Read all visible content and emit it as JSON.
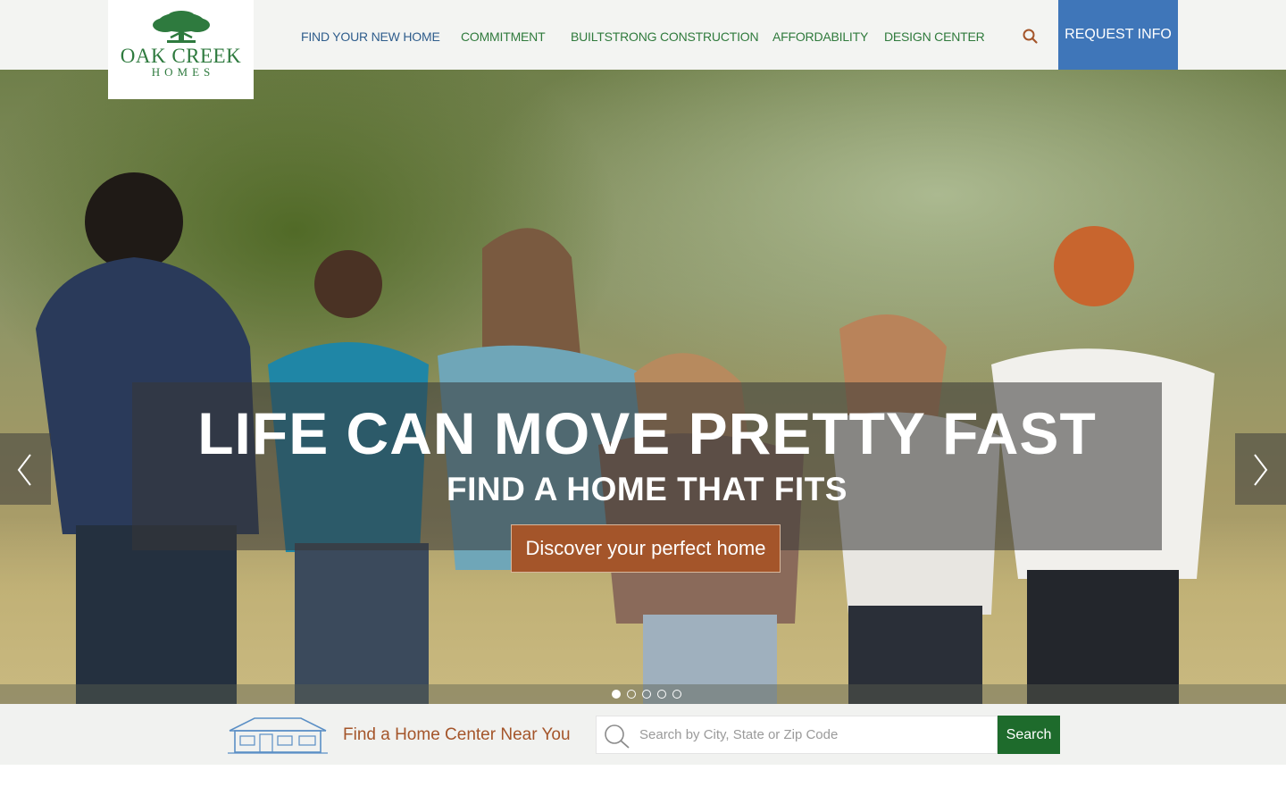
{
  "brand": {
    "name": "OAK CREEK",
    "sub": "HOMES"
  },
  "nav": {
    "items": [
      {
        "label": "FIND YOUR NEW HOME"
      },
      {
        "label": "COMMITMENT"
      },
      {
        "label": "BUILTSTRONG CONSTRUCTION"
      },
      {
        "label": "AFFORDABILITY"
      },
      {
        "label": "DESIGN CENTER"
      }
    ],
    "search_icon": "search-icon",
    "request_label": "REQUEST INFO"
  },
  "hero": {
    "headline": "LIFE CAN MOVE PRETTY FAST",
    "subhead": "FIND A HOME THAT FITS",
    "cta_label": "Discover your perfect home",
    "prev_icon": "chevron-left-icon",
    "next_icon": "chevron-right-icon",
    "slide_count": 5,
    "active_slide": 1
  },
  "find_center": {
    "icon": "house-icon",
    "label": "Find a Home Center Near You",
    "search_placeholder": "Search by City, State or Zip Code",
    "search_value": "",
    "button_label": "Search"
  },
  "colors": {
    "brand_green": "#2e7a3e",
    "nav_active": "#2f5d8c",
    "request_blue": "#3f76b9",
    "cta_brown": "#a4552a",
    "search_green": "#1e6b2c"
  }
}
